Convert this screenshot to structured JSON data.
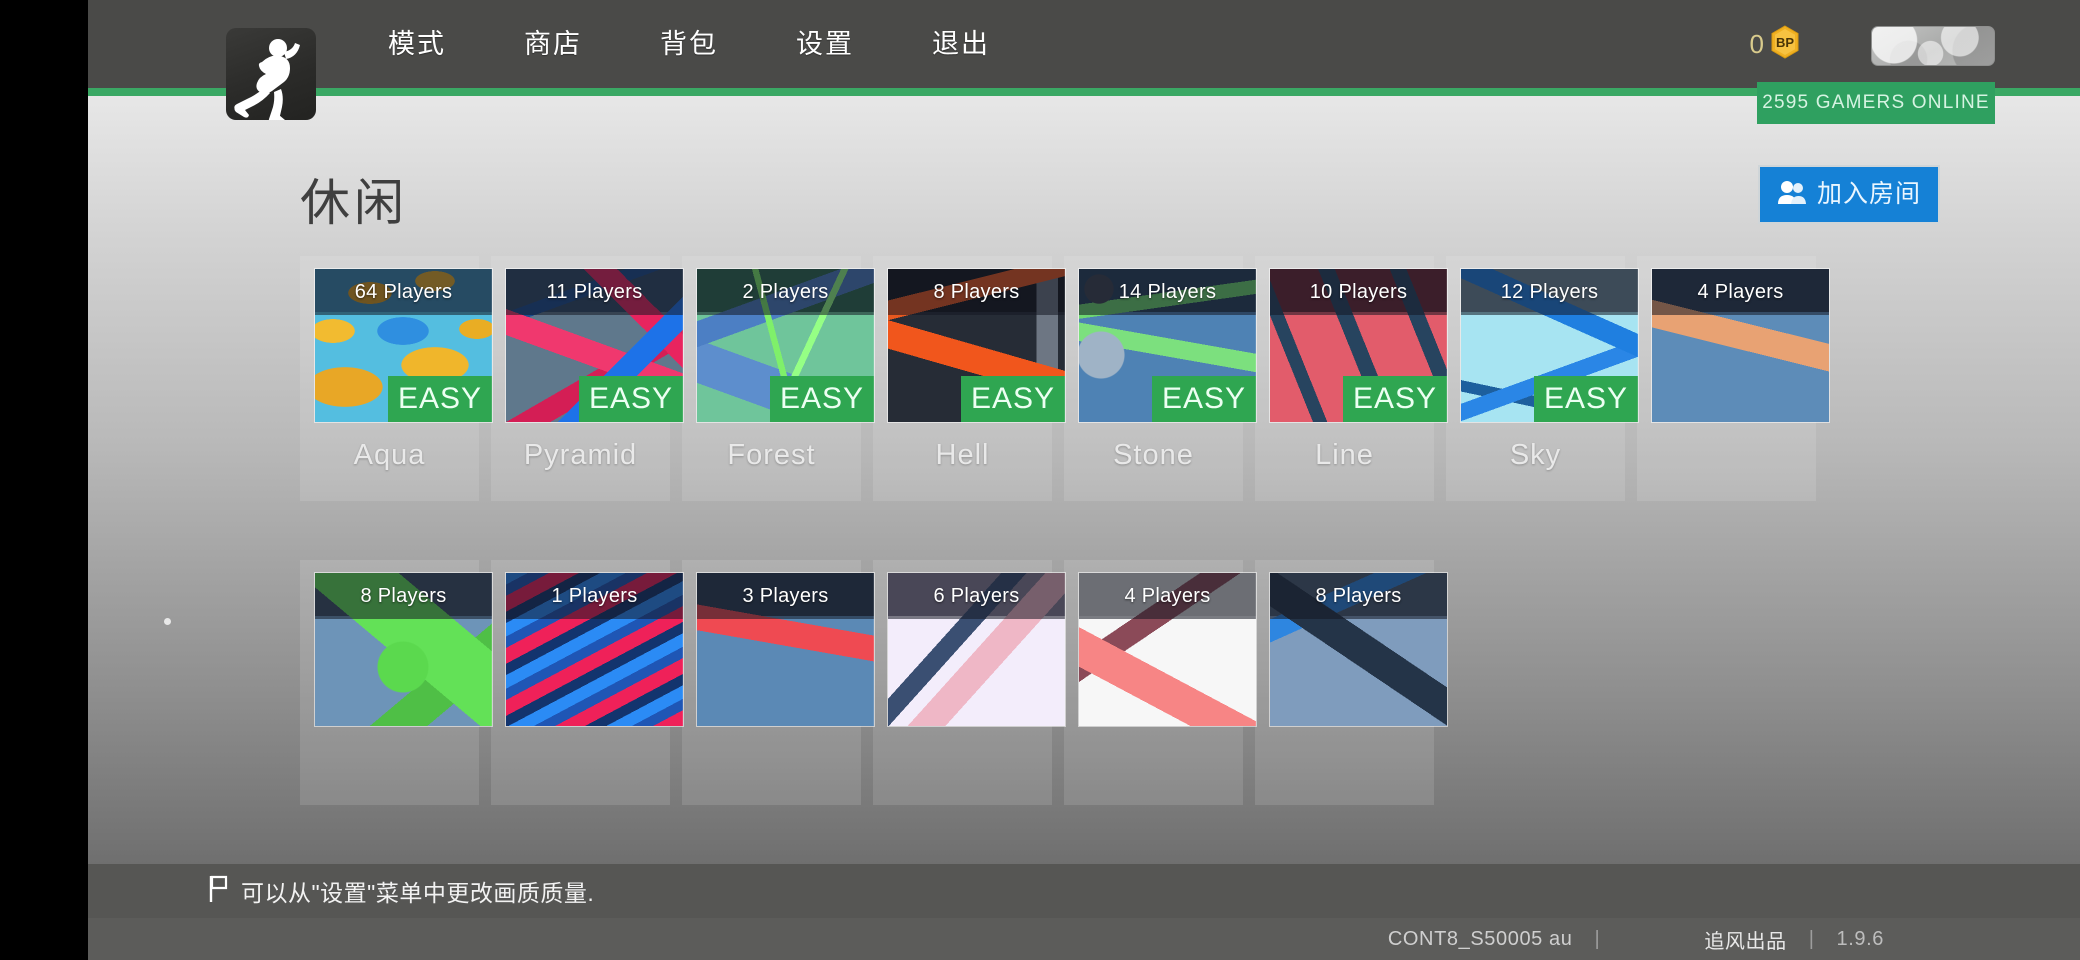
{
  "header": {
    "logo_icon": "running-figure-logo",
    "nav_items": [
      {
        "label": "模式",
        "name": "mode"
      },
      {
        "label": "商店",
        "name": "shop"
      },
      {
        "label": "背包",
        "name": "backpack"
      },
      {
        "label": "设置",
        "name": "settings"
      },
      {
        "label": "退出",
        "name": "exit"
      }
    ],
    "currency": {
      "value": "0",
      "icon": "bp-gem-icon",
      "icon_label": "BP",
      "color": "#f0b022"
    },
    "avatar_name": "player-avatar",
    "online_banner": {
      "text": "2595 GAMERS ONLINE",
      "color": "#2fa060"
    }
  },
  "page": {
    "title": "休闲",
    "join_room": {
      "label": "加入房间",
      "icon": "people-icon",
      "color": "#1581d6"
    }
  },
  "maps": {
    "row1": [
      {
        "name": "Aqua",
        "players": "64 Players",
        "difficulty": "EASY"
      },
      {
        "name": "Pyramid",
        "players": "11 Players",
        "difficulty": "EASY"
      },
      {
        "name": "Forest",
        "players": "2 Players",
        "difficulty": "EASY"
      },
      {
        "name": "Hell",
        "players": "8 Players",
        "difficulty": "EASY"
      },
      {
        "name": "Stone",
        "players": "14 Players",
        "difficulty": "EASY"
      },
      {
        "name": "Line",
        "players": "10 Players",
        "difficulty": "EASY"
      },
      {
        "name": "Sky",
        "players": "12 Players",
        "difficulty": "EASY"
      }
    ],
    "row2": [
      {
        "name": "",
        "players": "4 Players",
        "difficulty": ""
      },
      {
        "name": "",
        "players": "8 Players",
        "difficulty": ""
      },
      {
        "name": "",
        "players": "1 Players",
        "difficulty": ""
      },
      {
        "name": "",
        "players": "3 Players",
        "difficulty": ""
      },
      {
        "name": "",
        "players": "6 Players",
        "difficulty": ""
      },
      {
        "name": "",
        "players": "4 Players",
        "difficulty": ""
      },
      {
        "name": "",
        "players": "8 Players",
        "difficulty": ""
      }
    ]
  },
  "tip": {
    "icon": "flag-icon",
    "text": "可以从\"设置\"菜单中更改画质质量."
  },
  "footer": {
    "build": "CONT8_S50005 au",
    "separator": "|",
    "brand": "追风出品",
    "version": "1.9.6"
  }
}
